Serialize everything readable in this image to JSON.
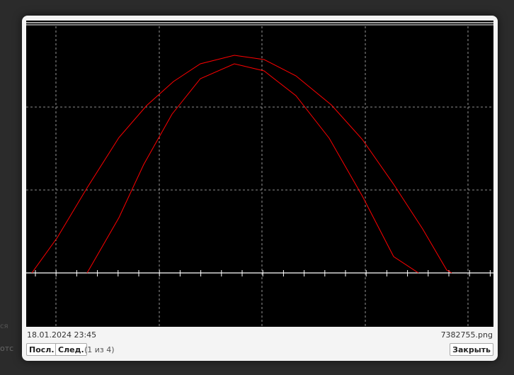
{
  "background": {
    "text_fragment_1": "ся",
    "text_fragment_2": "отс"
  },
  "lightbox": {
    "date": "18.01.2024 23:45",
    "filename": "7382755.png",
    "prev_label": "Посл.",
    "next_label": "След.",
    "counter": "(1 из 4)",
    "close_label": "Закрыть"
  },
  "colors": {
    "plot_background": "#000000",
    "curve": "#ff0000",
    "grid": "#bbbbbb",
    "axis": "#ffffff"
  }
}
